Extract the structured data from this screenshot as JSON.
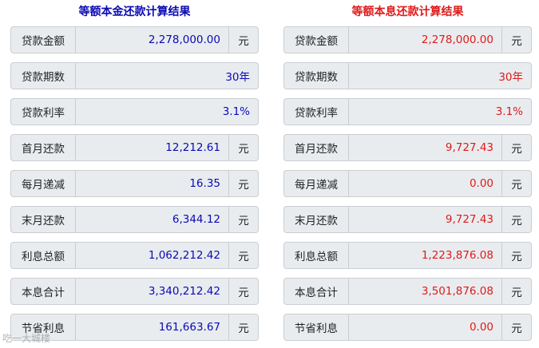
{
  "left_panel": {
    "title": "等额本金还款计算结果",
    "rows": [
      {
        "label": "贷款金额",
        "value": "2,278,000.00",
        "unit": "元"
      },
      {
        "label": "贷款期数",
        "value": "30年",
        "unit": ""
      },
      {
        "label": "贷款利率",
        "value": "3.1%",
        "unit": ""
      },
      {
        "label": "首月还款",
        "value": "12,212.61",
        "unit": "元"
      },
      {
        "label": "每月递减",
        "value": "16.35",
        "unit": "元"
      },
      {
        "label": "末月还款",
        "value": "6,344.12",
        "unit": "元"
      },
      {
        "label": "利息总额",
        "value": "1,062,212.42",
        "unit": "元"
      },
      {
        "label": "本息合计",
        "value": "3,340,212.42",
        "unit": "元"
      },
      {
        "label": "节省利息",
        "value": "161,663.67",
        "unit": "元"
      }
    ]
  },
  "right_panel": {
    "title": "等额本息还款计算结果",
    "rows": [
      {
        "label": "贷款金额",
        "value": "2,278,000.00",
        "unit": "元"
      },
      {
        "label": "贷款期数",
        "value": "30年",
        "unit": ""
      },
      {
        "label": "贷款利率",
        "value": "3.1%",
        "unit": ""
      },
      {
        "label": "首月还款",
        "value": "9,727.43",
        "unit": "元"
      },
      {
        "label": "每月递减",
        "value": "0.00",
        "unit": "元"
      },
      {
        "label": "末月还款",
        "value": "9,727.43",
        "unit": "元"
      },
      {
        "label": "利息总额",
        "value": "1,223,876.08",
        "unit": "元"
      },
      {
        "label": "本息合计",
        "value": "3,501,876.08",
        "unit": "元"
      },
      {
        "label": "节省利息",
        "value": "0.00",
        "unit": "元"
      }
    ]
  },
  "watermark": "吃一大城楼",
  "colors": {
    "left_accent": "#0a0ab4",
    "right_accent": "#e01a1a",
    "cell_bg": "#e9ecef",
    "border": "#c9cdd2"
  }
}
